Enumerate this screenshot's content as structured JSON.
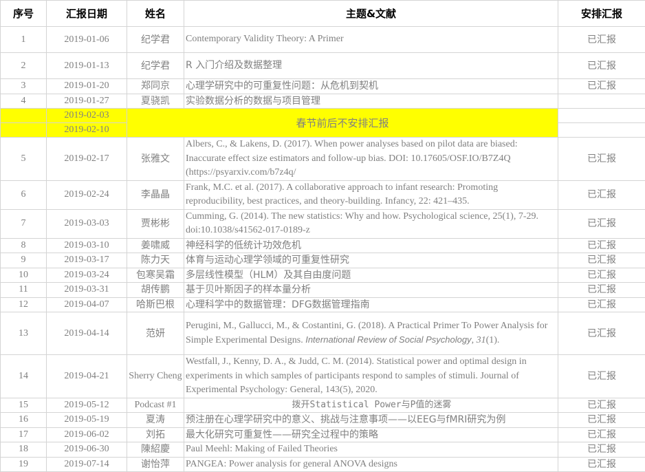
{
  "headers": {
    "num": "序号",
    "date": "汇报日期",
    "name": "姓名",
    "topic": "主题&文献",
    "status": "安排汇报"
  },
  "rows": [
    {
      "num": "1",
      "date": "2019-01-06",
      "name": "纪学君",
      "topic": "Contemporary Validity Theory: A Primer",
      "status": "已汇报"
    },
    {
      "num": "2",
      "date": "2019-01-13",
      "name": "纪学君",
      "topic": "R 入门介绍及数据整理",
      "status": "已汇报"
    },
    {
      "num": "3",
      "date": "2019-01-20",
      "name": "郑同京",
      "topic": "心理学研究中的可重复性问题：从危机到契机",
      "status": "已汇报"
    },
    {
      "num": "4",
      "date": "2019-01-27",
      "name": "夏骁凯",
      "topic": "实验数据分析的数据与项目管理",
      "status": ""
    }
  ],
  "holiday": {
    "date1": "2019-02-03",
    "date2": "2019-02-10",
    "note": "春节前后不安排汇报",
    "color": "#ffff00"
  },
  "rows2": [
    {
      "num": "5",
      "date": "2019-02-17",
      "name": "张雅文",
      "topic": "Albers, C., & Lakens, D. (2017). When power analyses based on pilot data are biased: Inaccurate effect size estimators and follow-up bias. DOI: 10.17605/OSF.IO/B7Z4Q (https://psyarxiv.com/b7z4q/",
      "status": "已汇报"
    },
    {
      "num": "6",
      "date": "2019-02-24",
      "name": "李晶晶",
      "topic": "Frank, M.C. et al. (2017). A collaborative approach to infant research: Promoting reproducibility, best practices, and theory-building. Infancy, 22: 421–435.",
      "status": "已汇报"
    },
    {
      "num": "7",
      "date": "2019-03-03",
      "name": "贾彬彬",
      "topic": "Cumming, G. (2014). The new statistics: Why and how. Psychological science, 25(1), 7-29. doi:10.1038/s41562-017-0189-z",
      "status": "已汇报"
    },
    {
      "num": "8",
      "date": "2019-03-10",
      "name": "姜啸威",
      "topic": "神经科学的低统计功效危机",
      "status": "已汇报"
    },
    {
      "num": "9",
      "date": "2019-03-17",
      "name": "陈力天",
      "topic": "体育与运动心理学领域的可重复性研究",
      "status": "已汇报"
    },
    {
      "num": "10",
      "date": "2019-03-24",
      "name": "包寒吴霜",
      "topic": "多层线性模型（HLM）及其自由度问题",
      "status": "已汇报"
    },
    {
      "num": "11",
      "date": "2019-03-31",
      "name": "胡传鹏",
      "topic": "基于贝叶斯因子的样本量分析",
      "status": "已汇报"
    },
    {
      "num": "12",
      "date": "2019-04-07",
      "name": "哈斯巴根",
      "topic": "心理科学中的数据管理：DFG数据管理指南",
      "status": "已汇报"
    }
  ],
  "row13": {
    "num": "13",
    "date": "2019-04-14",
    "name": "范妍",
    "topic_a": "Perugini, M., Gallucci, M., & Costantini, G. (2018). A Practical Primer To Power Analysis for Simple Experimental Designs. ",
    "topic_journal": "International Review of Social Psychology",
    "topic_b": ", ",
    "topic_vol": "31",
    "topic_c": "(1).",
    "status": "已汇报"
  },
  "row14": {
    "num": "14",
    "date": "2019-04-21",
    "name": "Sherry Cheng",
    "topic": "Westfall, J., Kenny, D. A., & Judd, C. M. (2014). Statistical power and optimal design in experiments in which samples of participants respond to samples of stimuli. Journal of Experimental Psychology: General, 143(5), 2020.",
    "status": "已汇报"
  },
  "row15": {
    "num": "15",
    "date": "2019-05-12",
    "name": "Podcast #1",
    "topic": "拨开Statistical Power与P值的迷雾",
    "status": "已汇报"
  },
  "rows3": [
    {
      "num": "16",
      "date": "2019-05-19",
      "name": "夏涛",
      "topic": "预注册在心理学研究中的意义、挑战与注意事项——以EEG与fMRI研究为例",
      "status": "已汇报"
    },
    {
      "num": "17",
      "date": "2019-06-02",
      "name": "刘拓",
      "topic": " 最大化研究可重复性——研究全过程中的策略",
      "status": "已汇报"
    },
    {
      "num": "18",
      "date": "2019-06-30",
      "name": "陳紹慶",
      "topic": "Paul Meehl: Making of Failed Theories",
      "status": "已汇报"
    },
    {
      "num": "19",
      "date": "2019-07-14",
      "name": "谢怡萍",
      "topic": "PANGEA: Power analysis for general ANOVA designs",
      "status": "已汇报"
    }
  ]
}
